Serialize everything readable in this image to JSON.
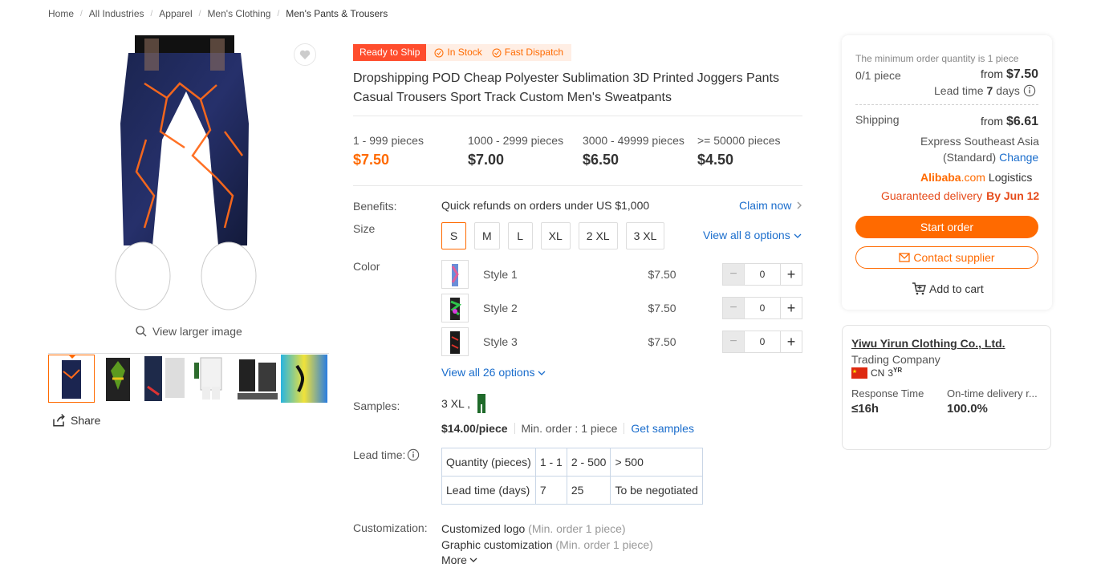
{
  "breadcrumb": [
    "Home",
    "All Industries",
    "Apparel",
    "Men's Clothing",
    "Men's Pants & Trousers"
  ],
  "gallery": {
    "view_larger": "View larger image",
    "share": "Share",
    "thumb_count": 6
  },
  "badges": {
    "ready": "Ready to Ship",
    "in_stock": "In Stock",
    "fast_dispatch": "Fast Dispatch"
  },
  "product": {
    "title_line1": "Dropshipping POD Cheap Polyester Sublimation 3D Printed Joggers Pants",
    "title_line2": "Casual Trousers Sport Track Custom Men's Sweatpants"
  },
  "tiers": [
    {
      "qty": "1 - 999 pieces",
      "price": "$7.50"
    },
    {
      "qty": "1000 - 2999 pieces",
      "price": "$7.00"
    },
    {
      "qty": "3000 - 49999 pieces",
      "price": "$6.50"
    },
    {
      "qty": ">= 50000 pieces",
      "price": "$4.50"
    }
  ],
  "benefits": {
    "label": "Benefits:",
    "text": "Quick refunds on orders under US $1,000",
    "claim": "Claim now"
  },
  "size": {
    "label": "Size",
    "options": [
      "S",
      "M",
      "L",
      "XL",
      "2 XL",
      "3 XL"
    ],
    "selected": "S",
    "view_all": "View all 8 options"
  },
  "color": {
    "label": "Color",
    "rows": [
      {
        "name": "Style 1",
        "price": "$7.50",
        "qty": "0"
      },
      {
        "name": "Style 2",
        "price": "$7.50",
        "qty": "0"
      },
      {
        "name": "Style 3",
        "price": "$7.50",
        "qty": "0"
      }
    ],
    "view_all": "View all 26 options"
  },
  "samples": {
    "label": "Samples:",
    "size": "3 XL ,",
    "price": "$14.00/piece",
    "min_order": "Min. order : 1 piece",
    "get_samples": "Get samples"
  },
  "lead_time": {
    "label": "Lead time:",
    "rows": [
      [
        "Quantity (pieces)",
        "1 - 1",
        "2 - 500",
        "> 500"
      ],
      [
        "Lead time (days)",
        "7",
        "25",
        "To be negotiated"
      ]
    ]
  },
  "customization": {
    "label": "Customization:",
    "items": [
      {
        "name": "Customized logo",
        "note": "(Min. order 1 piece)"
      },
      {
        "name": "Graphic customization",
        "note": "(Min. order 1 piece)"
      }
    ],
    "more": "More"
  },
  "order_card": {
    "min_note": "The minimum order quantity is 1 piece",
    "count": "0/1 piece",
    "from": "from",
    "price": "$7.50",
    "lead_label": "Lead time",
    "lead_days": "7",
    "lead_unit": "days",
    "shipping_label": "Shipping",
    "shipping_price": "$6.61",
    "ship_method_1": "Express Southeast Asia",
    "ship_method_2": "(Standard)",
    "change": "Change",
    "brand_a": "Alibaba",
    "brand_b": ".com",
    "logistics": "Logistics",
    "guaranteed": "Guaranteed delivery",
    "by_date": "By Jun 12",
    "start_order": "Start order",
    "contact": "Contact supplier",
    "add_cart": "Add to cart"
  },
  "supplier": {
    "name": "Yiwu Yirun Clothing Co., Ltd.",
    "type": "Trading Company",
    "country": "CN",
    "years": "3",
    "years_unit": "YR",
    "response_label": "Response Time",
    "response_value": "≤16h",
    "ontime_label": "On-time delivery r...",
    "ontime_value": "100.0%"
  },
  "colors": {
    "accent": "#ff6a00",
    "link": "#1a6dcc",
    "badge_red": "#ff4d2d"
  }
}
